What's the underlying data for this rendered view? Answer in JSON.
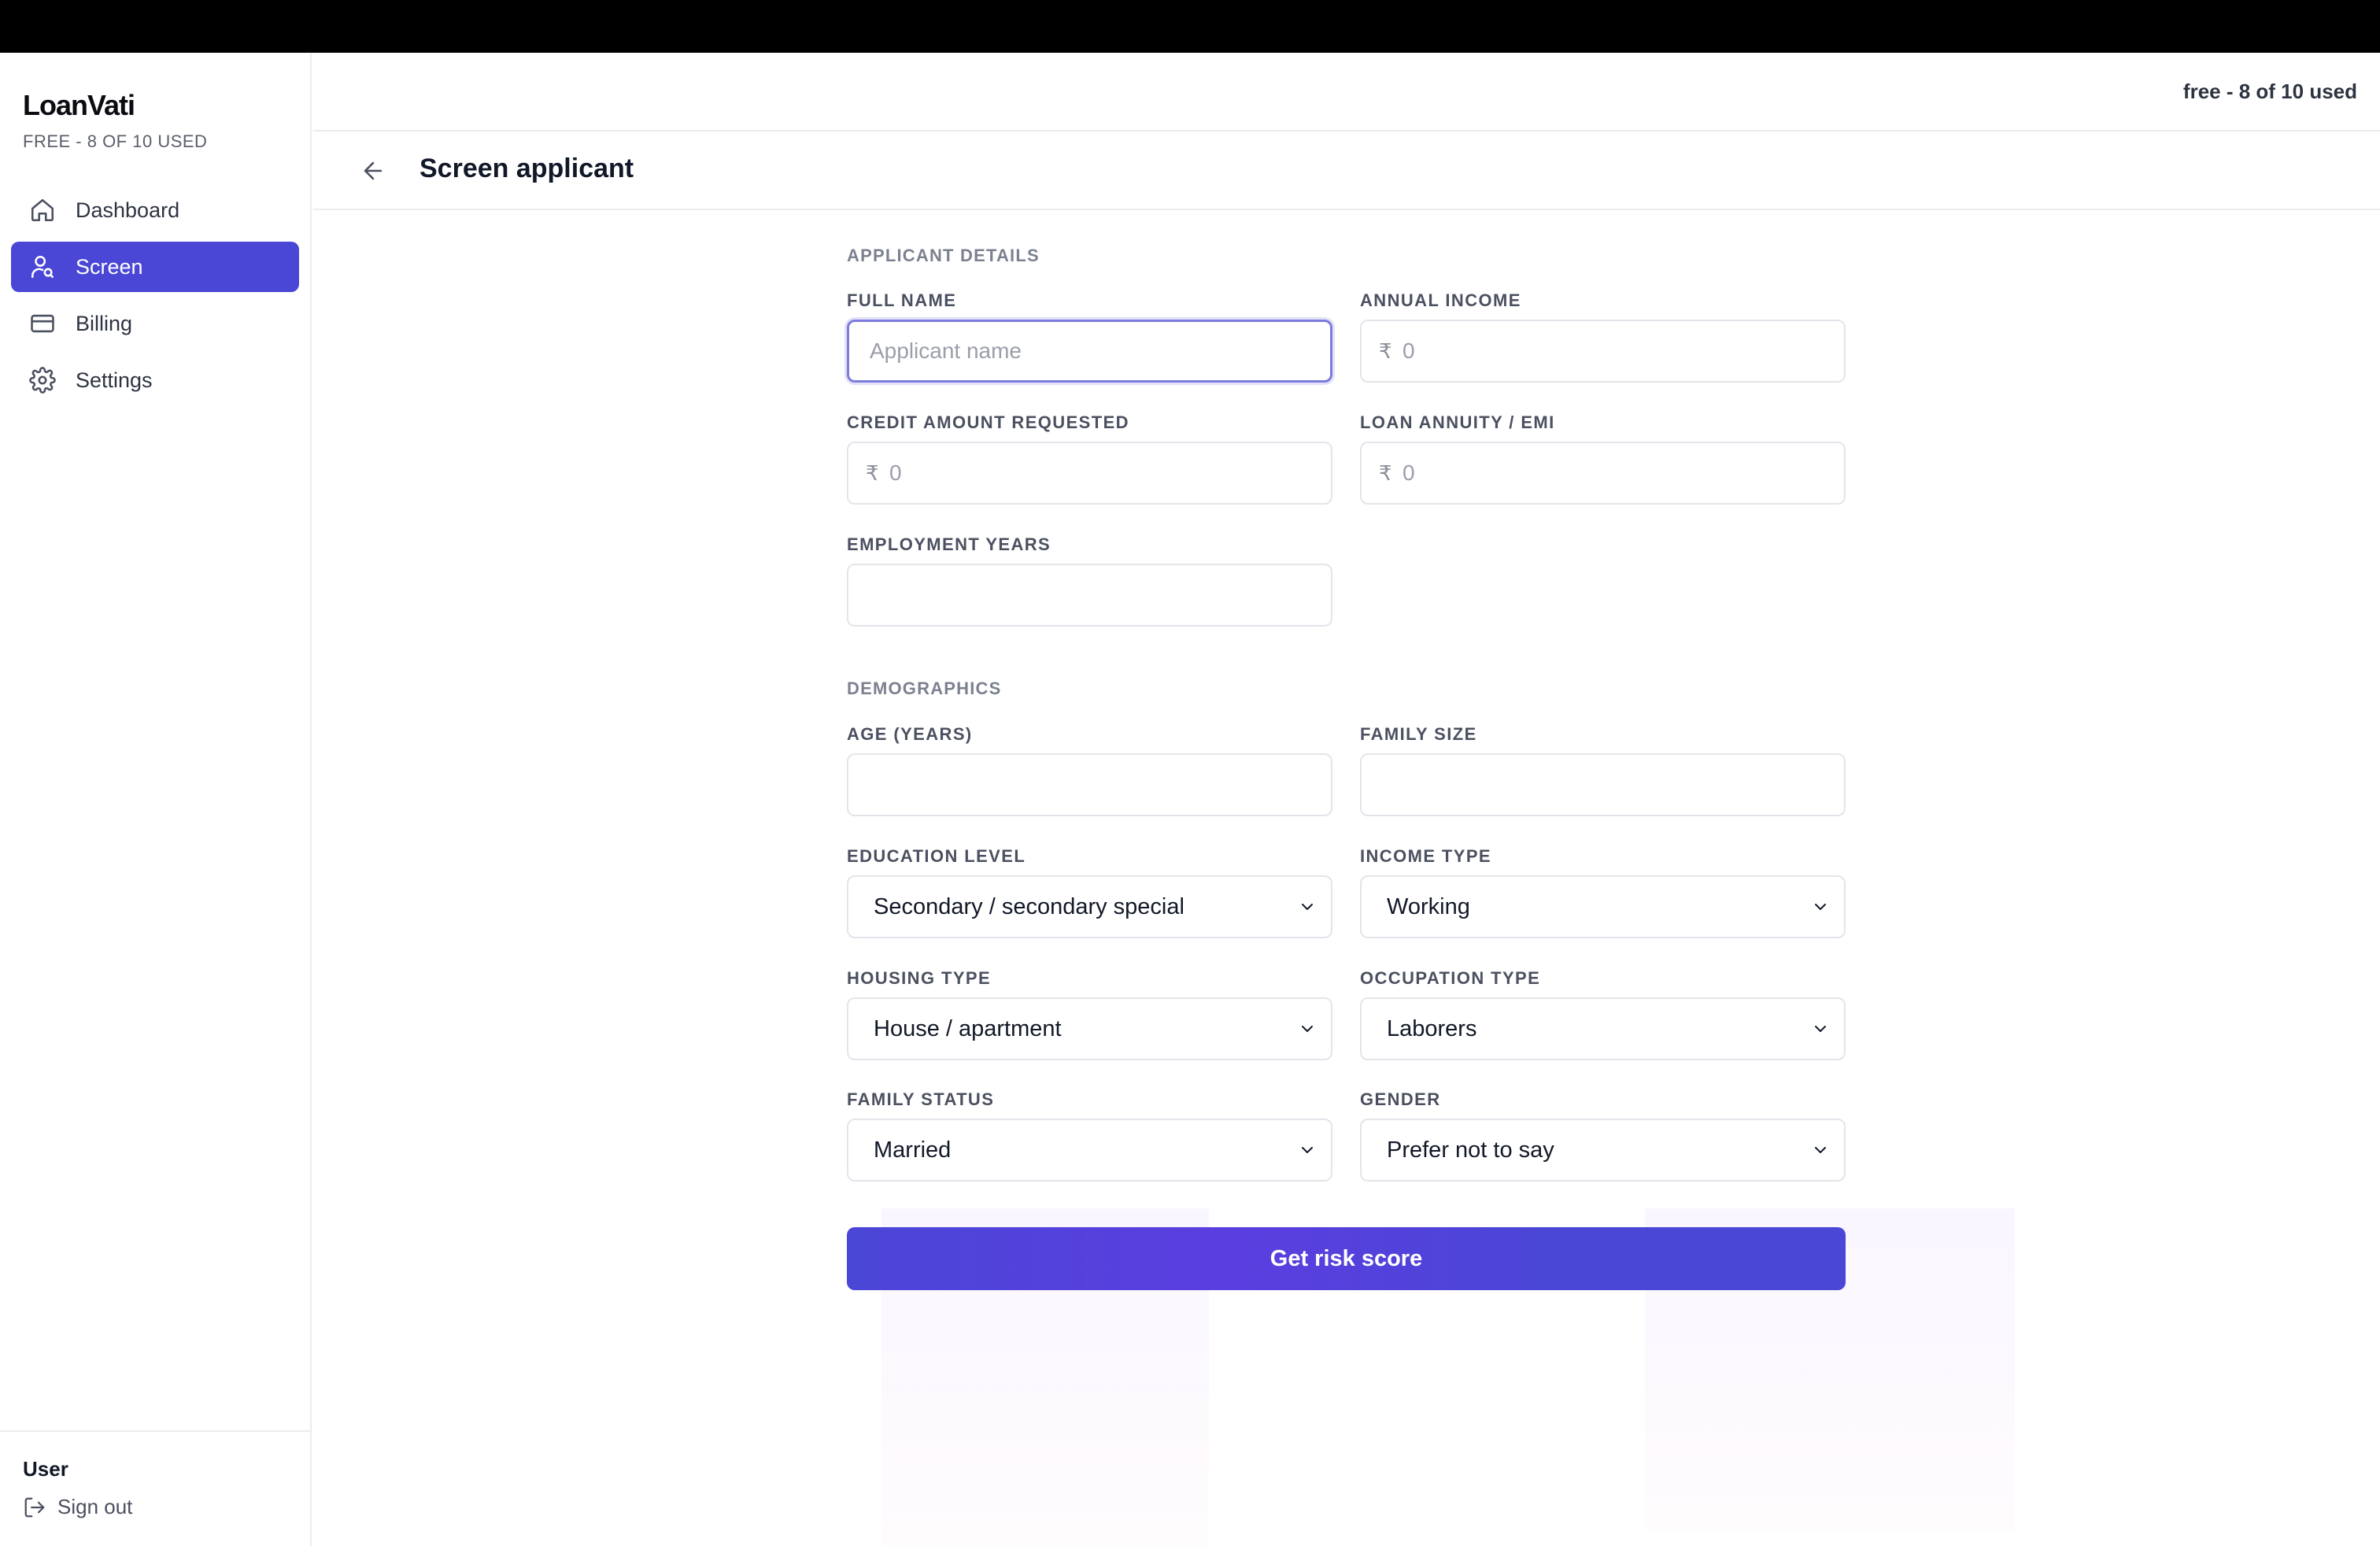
{
  "app": {
    "name": "LoanVati",
    "plan": "FREE - 8 OF 10 USED",
    "usage": "free - 8 of 10 used"
  },
  "nav": [
    {
      "label": "Dashboard",
      "icon": "home-icon",
      "active": false
    },
    {
      "label": "Screen",
      "icon": "user-search-icon",
      "active": true
    },
    {
      "label": "Billing",
      "icon": "credit-card-icon",
      "active": false
    },
    {
      "label": "Settings",
      "icon": "gear-icon",
      "active": false
    }
  ],
  "user": {
    "name": "User",
    "signout": "Sign out"
  },
  "page": {
    "title": "Screen applicant"
  },
  "form": {
    "applicant_section": "APPLICANT DETAILS",
    "full_name": {
      "label": "FULL NAME",
      "placeholder": "Applicant name"
    },
    "annual_income": {
      "label": "ANNUAL INCOME",
      "currency": "₹",
      "placeholder": "0"
    },
    "credit_amount": {
      "label": "CREDIT AMOUNT REQUESTED",
      "currency": "₹",
      "placeholder": "0"
    },
    "loan_annuity": {
      "label": "LOAN ANNUITY / EMI",
      "currency": "₹",
      "placeholder": "0"
    },
    "employment_years": {
      "label": "EMPLOYMENT YEARS",
      "value": ""
    },
    "demographics_section": "DEMOGRAPHICS",
    "age": {
      "label": "AGE (YEARS)",
      "value": ""
    },
    "family_size": {
      "label": "FAMILY SIZE",
      "value": ""
    },
    "education": {
      "label": "EDUCATION LEVEL",
      "value": "Secondary / secondary special"
    },
    "income_type": {
      "label": "INCOME TYPE",
      "value": "Working"
    },
    "housing": {
      "label": "HOUSING TYPE",
      "value": "House / apartment"
    },
    "occupation": {
      "label": "OCCUPATION TYPE",
      "value": "Laborers"
    },
    "family_status": {
      "label": "FAMILY STATUS",
      "value": "Married"
    },
    "gender": {
      "label": "GENDER",
      "value": "Prefer not to say"
    },
    "submit": "Get risk score"
  },
  "colors": {
    "accent": "#4a46d6",
    "topbar": "#000000"
  }
}
